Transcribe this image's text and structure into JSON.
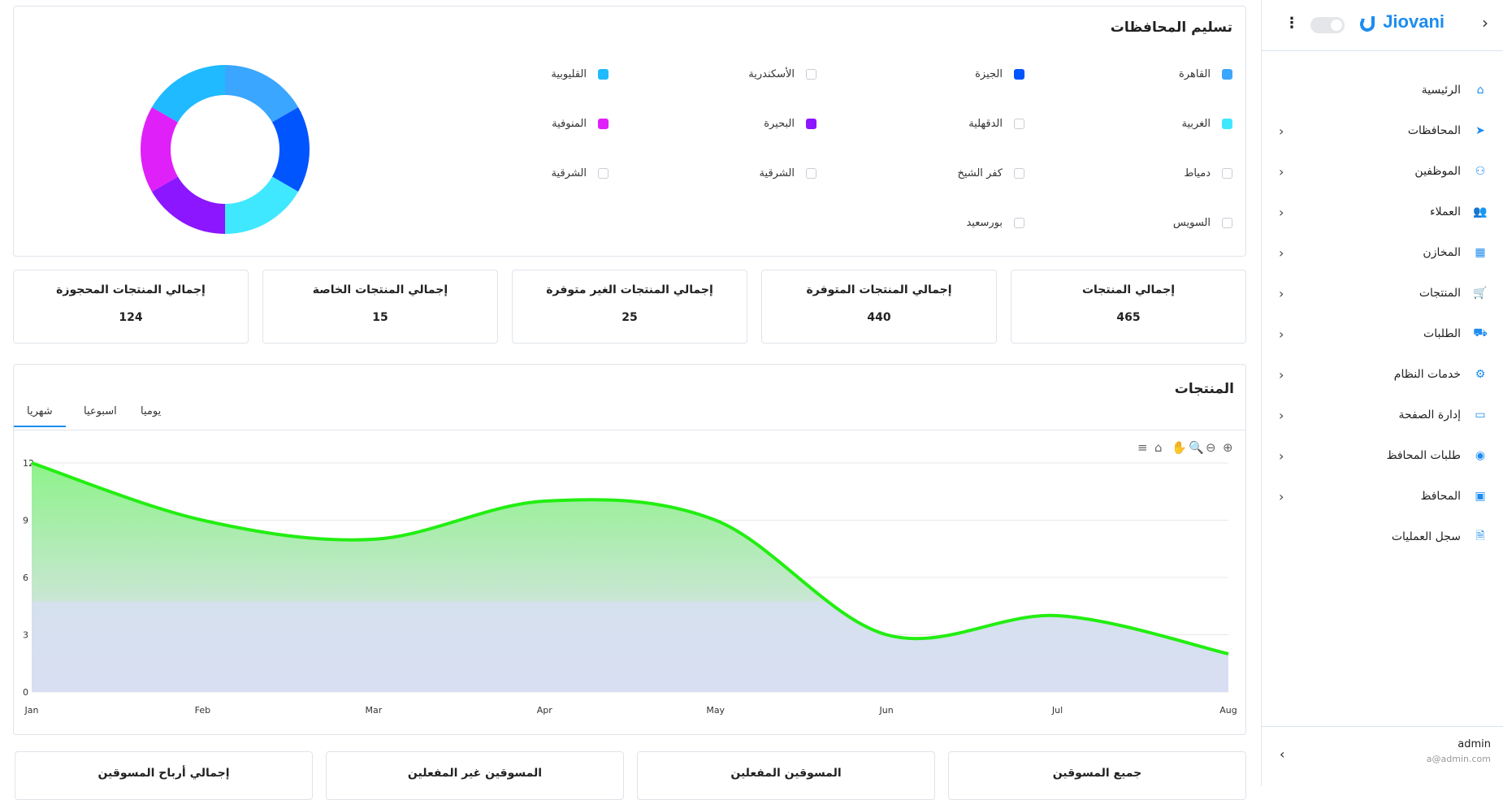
{
  "sidebar": {
    "brand": "Jiovani",
    "items": [
      {
        "label": "الرئيسية",
        "icon": "home-icon",
        "chevron": false
      },
      {
        "label": "المحافظات",
        "icon": "send-icon",
        "chevron": true
      },
      {
        "label": "الموظفين",
        "icon": "team-icon",
        "chevron": true
      },
      {
        "label": "العملاء",
        "icon": "users-icon",
        "chevron": true
      },
      {
        "label": "المخازن",
        "icon": "warehouse-icon",
        "chevron": true
      },
      {
        "label": "المنتجات",
        "icon": "cart-icon",
        "chevron": true
      },
      {
        "label": "الطلبات",
        "icon": "truck-icon",
        "chevron": true
      },
      {
        "label": "خدمات النظام",
        "icon": "gear-icon",
        "chevron": true
      },
      {
        "label": "إدارة الصفحة",
        "icon": "window-icon",
        "chevron": true
      },
      {
        "label": "طلبات المحافظ",
        "icon": "coin-icon",
        "chevron": true
      },
      {
        "label": "المحافظ",
        "icon": "wallet-icon",
        "chevron": true
      },
      {
        "label": "سجل العمليات",
        "icon": "file-icon",
        "chevron": false
      }
    ],
    "user": {
      "name": "admin",
      "email": "a@admin.com"
    }
  },
  "provinces": {
    "title": "تسليم المحافظات",
    "legend": [
      {
        "label": "القاهرة",
        "checked": true,
        "color": "#3aa6ff"
      },
      {
        "label": "الجيزة",
        "checked": true,
        "color": "#0055ff"
      },
      {
        "label": "الأسكندرية",
        "checked": false
      },
      {
        "label": "القليوبية",
        "checked": true,
        "color": "#1fbaff"
      },
      {
        "label": "الغربية",
        "checked": true,
        "color": "#40e8ff"
      },
      {
        "label": "الدقهلية",
        "checked": false
      },
      {
        "label": "البحيرة",
        "checked": true,
        "color": "#8b16ff"
      },
      {
        "label": "المنوفية",
        "checked": true,
        "color": "#e020f8"
      },
      {
        "label": "دمياط",
        "checked": false
      },
      {
        "label": "كفر الشيخ",
        "checked": false
      },
      {
        "label": "الشرقية",
        "checked": false
      },
      {
        "label": "الشرقية",
        "checked": false
      },
      {
        "label": "السويس",
        "checked": false
      },
      {
        "label": "بورسعيد",
        "checked": false
      }
    ]
  },
  "stats": [
    {
      "label": "إجمالي المنتجات",
      "value": "465"
    },
    {
      "label": "إجمالي المنتجات المتوفرة",
      "value": "440"
    },
    {
      "label": "إجمالي المنتجات الغير متوفرة",
      "value": "25"
    },
    {
      "label": "إجمالي المنتجات الخاصة",
      "value": "15"
    },
    {
      "label": "إجمالي المنتجات المحجوزة",
      "value": "124"
    }
  ],
  "products": {
    "title": "المنتجات",
    "tabs": [
      {
        "label": "شهريا",
        "active": true
      },
      {
        "label": "اسبوعيا",
        "active": false
      },
      {
        "label": "يوميا",
        "active": false
      }
    ],
    "toolbar": [
      "zoom-in-icon",
      "zoom-out-icon",
      "zoom-select-icon",
      "pan-icon",
      "reset-home-icon",
      "menu-icon"
    ]
  },
  "marketers": [
    "جميع المسوقين",
    "المسوقين المفعلين",
    "المسوقين غير المفعلين",
    "إجمالي أرباح المسوقين"
  ],
  "chart_data": [
    {
      "type": "pie",
      "donut": true,
      "categories": [
        "القاهرة",
        "الجيزة",
        "الغربية",
        "البحيرة",
        "المنوفية",
        "القليوبية"
      ],
      "values": [
        1,
        1,
        1,
        1,
        1,
        1
      ],
      "colors": [
        "#3aa6ff",
        "#0055ff",
        "#40e8ff",
        "#8b16ff",
        "#e020f8",
        "#1fbaff"
      ]
    },
    {
      "type": "area",
      "categories": [
        "Jan",
        "Feb",
        "Mar",
        "Apr",
        "May",
        "Jun",
        "Jul",
        "Aug"
      ],
      "values": [
        12,
        9,
        8,
        10,
        9,
        3,
        4,
        2
      ],
      "ylim": [
        0,
        12
      ],
      "yticks": [
        0,
        3,
        6,
        9,
        12
      ],
      "grid": true,
      "line_color": "#22ee11"
    }
  ]
}
